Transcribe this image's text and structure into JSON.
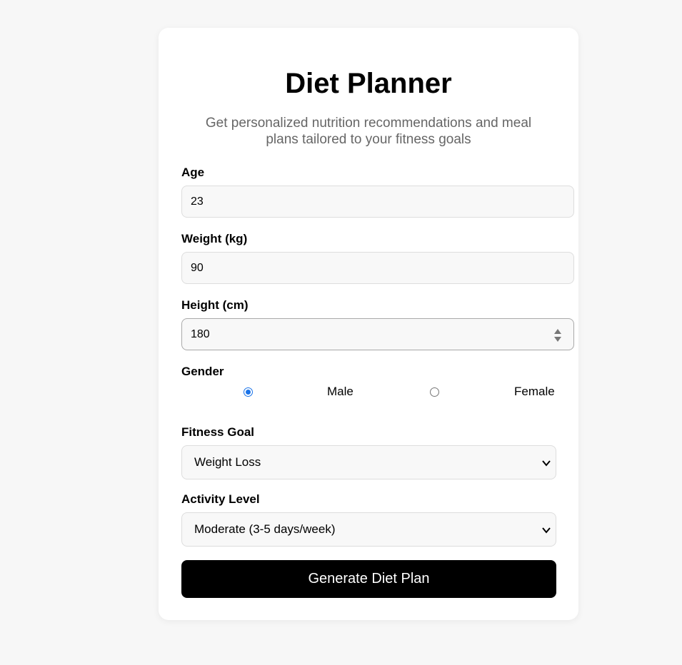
{
  "header": {
    "title": "Diet Planner",
    "subtitle": "Get personalized nutrition recommendations and meal plans tailored to your fitness goals"
  },
  "form": {
    "age": {
      "label": "Age",
      "value": "23"
    },
    "weight": {
      "label": "Weight (kg)",
      "value": "90"
    },
    "height": {
      "label": "Height (cm)",
      "value": "180"
    },
    "gender": {
      "label": "Gender",
      "options": [
        {
          "label": "Male",
          "checked": true
        },
        {
          "label": "Female",
          "checked": false
        }
      ]
    },
    "fitness_goal": {
      "label": "Fitness Goal",
      "selected": "Weight Loss"
    },
    "activity_level": {
      "label": "Activity Level",
      "selected": "Moderate (3-5 days/week)"
    },
    "submit_label": "Generate Diet Plan"
  },
  "colors": {
    "page_background": "#f7f7f7",
    "card_background": "#ffffff",
    "accent_radio": "#1a73e8",
    "button_background": "#000000",
    "button_text": "#ffffff",
    "subtitle_text": "#666666"
  }
}
